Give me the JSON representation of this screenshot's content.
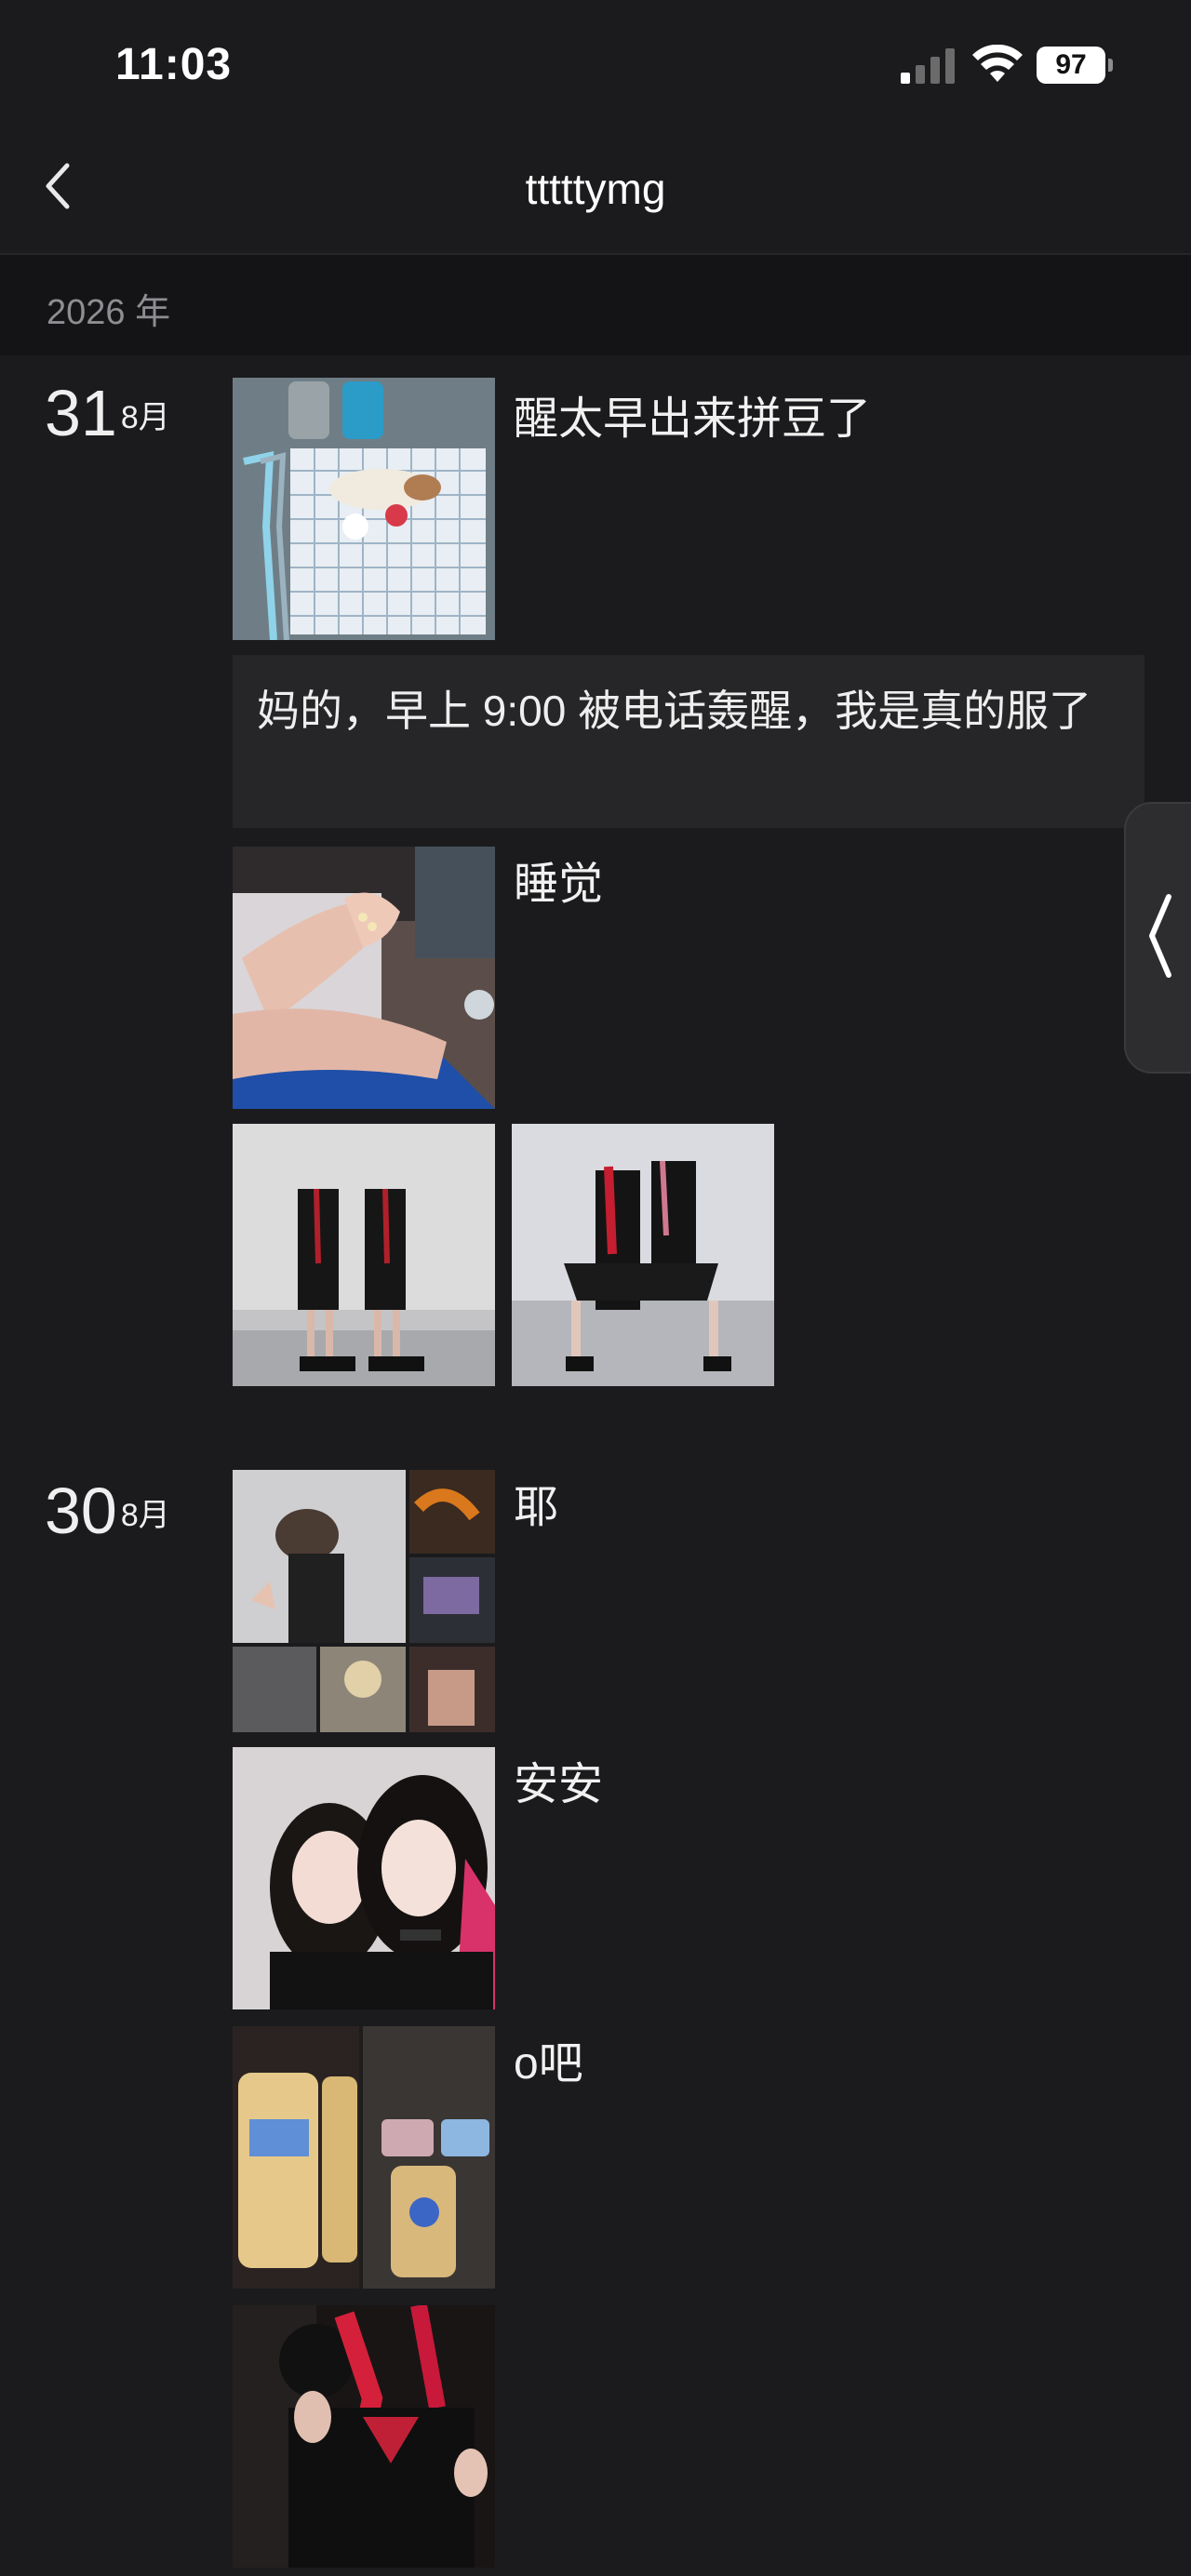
{
  "status_bar": {
    "time": "11:03",
    "battery": "97",
    "icons": [
      "cellular-signal-icon",
      "wifi-icon",
      "battery-icon"
    ]
  },
  "nav": {
    "title": "tttttymg",
    "back_icon": "chevron-left-icon"
  },
  "year_label": "2026 年",
  "days": [
    {
      "day": "31",
      "month": "8月",
      "posts": [
        {
          "type": "photo",
          "caption": "醒太早出来拼豆了"
        },
        {
          "type": "text",
          "text": "妈的，早上 9:00 被电话轰醒，我是真的服了"
        },
        {
          "type": "photo",
          "caption": "睡觉"
        },
        {
          "type": "photos",
          "count": 2,
          "caption": ""
        }
      ]
    },
    {
      "day": "30",
      "month": "8月",
      "posts": [
        {
          "type": "collage",
          "caption": "耶"
        },
        {
          "type": "photo",
          "caption": "安安"
        },
        {
          "type": "collage",
          "caption": "o吧"
        },
        {
          "type": "photo",
          "caption": ""
        }
      ]
    }
  ],
  "side_handle_icon": "chevron-left-icon",
  "colors": {
    "background": "#1b1b1d",
    "year_bar": "#141416",
    "text_card": "#262628",
    "text": "#e9e9ea"
  }
}
